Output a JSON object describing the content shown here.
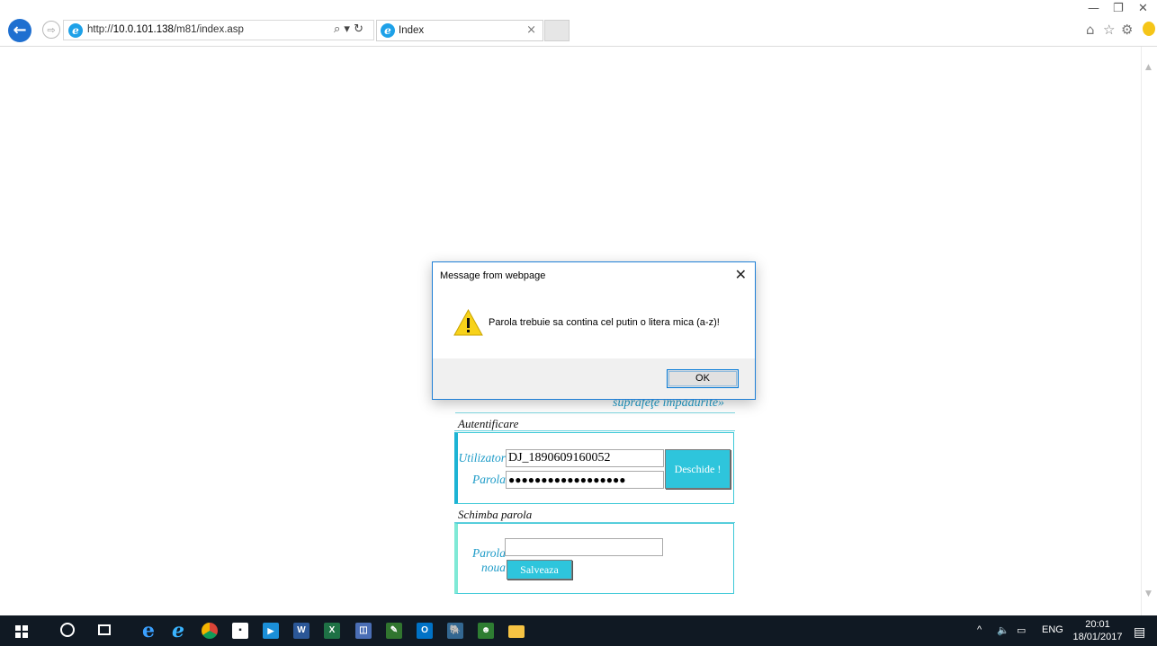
{
  "browser": {
    "url_prefix": "http://",
    "url_host": "10.0.101.138",
    "url_path": "/m81/index.asp",
    "tab_title": "Index",
    "search_glyph": "⌕ ▾ ↻"
  },
  "page": {
    "partial_link_text": "suprafeţe împădurite»",
    "login_section_title": "Autentificare",
    "user_label": "Utilizator",
    "user_value": "DJ_1890609160052",
    "password_label": "Parola",
    "password_value": "●●●●●●●●●●●●●●●●●●",
    "open_button": "Deschide !",
    "change_section_title": "Schimba parola",
    "new_password_label_line1": "Parola",
    "new_password_label_line2": "noua",
    "new_password_value": "",
    "save_button": "Salveaza"
  },
  "dialog": {
    "title": "Message from webpage",
    "message": "Parola trebuie sa contina cel putin o litera mica (a-z)!",
    "ok_label": "OK",
    "icon": "warning-icon"
  },
  "taskbar": {
    "tray_language": "ENG",
    "clock_time": "20:01",
    "clock_date": "18/01/2017",
    "apps": [
      "windows-start",
      "cortana-search",
      "task-view",
      "edge",
      "internet-explorer",
      "chrome",
      "store",
      "media-player",
      "word",
      "excel",
      "app-green",
      "project",
      "outlook",
      "postgresql",
      "app-user",
      "file-explorer"
    ]
  },
  "colors": {
    "accent_cyan": "#2ec5dc",
    "label_blue": "#1f9cc8",
    "dialog_border": "#1e7fd6",
    "taskbar": "#101923"
  }
}
